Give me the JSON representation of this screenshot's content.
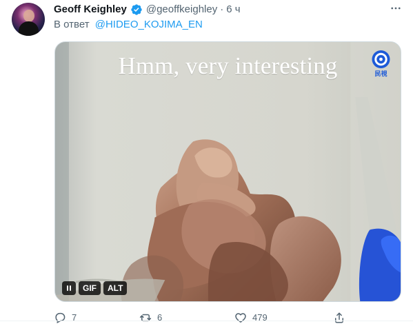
{
  "tweet": {
    "author": {
      "display_name": "Geoff Keighley",
      "handle": "@geoffkeighley",
      "separator": "·",
      "time": "6 ч",
      "verified_icon": "verified-badge-icon",
      "more_icon": "more-horizontal-icon"
    },
    "reply": {
      "prefix": "В ответ",
      "mention": "@HIDEO_KOJIMA_EN"
    },
    "media": {
      "caption": "Hmm, very interesting",
      "logo_text": "民視",
      "controls": {
        "pause_icon": "pause-icon",
        "gif_label": "GIF",
        "alt_label": "ALT"
      }
    },
    "actions": {
      "reply_count": "7",
      "retweet_count": "6",
      "like_count": "479",
      "reply_icon": "reply-icon",
      "retweet_icon": "retweet-icon",
      "like_icon": "heart-icon",
      "share_icon": "share-icon"
    }
  },
  "colors": {
    "verified": "#1d9bf0",
    "link": "#1d9bf0",
    "secondary_text": "#536471",
    "primary_text": "#0f1419"
  }
}
